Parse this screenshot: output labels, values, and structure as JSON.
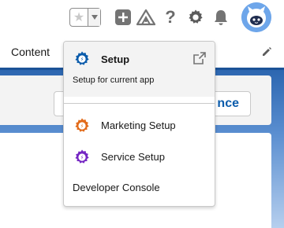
{
  "header": {
    "nav_tab": "Content"
  },
  "background": {
    "button_partial_text": "nce"
  },
  "setup_menu": {
    "setup_title": "Setup",
    "setup_subtitle": "Setup for current app",
    "items": [
      {
        "label": "Marketing Setup",
        "icon": "gear-icon",
        "color": "#e26b1a"
      },
      {
        "label": "Service Setup",
        "icon": "gear-icon",
        "color": "#7526c3"
      },
      {
        "label": "Developer Console"
      }
    ]
  },
  "colors": {
    "setup_gear": "#0b5cab",
    "marketing_gear": "#e26b1a",
    "service_gear": "#7526c3",
    "header_icons": "#747474",
    "brand_blue": "#1b5297"
  }
}
